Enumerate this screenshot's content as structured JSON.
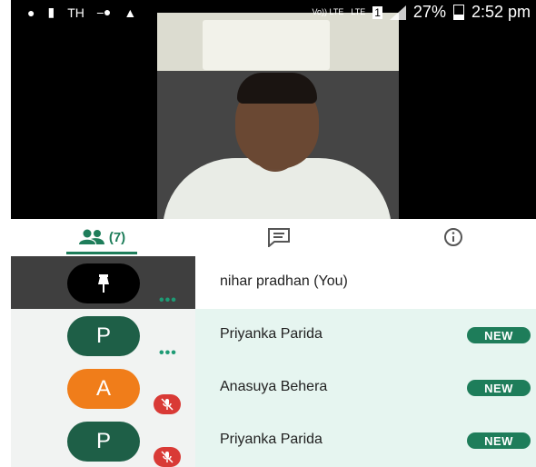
{
  "status_bar": {
    "carrier_text": "TH",
    "network_labels": [
      "Vo)) LTE",
      "LTE"
    ],
    "sim_slot": "1",
    "battery": "27%",
    "time": "2:52 pm"
  },
  "tabs": [
    {
      "name": "people",
      "icon": "people-icon",
      "count": "(7)",
      "selected": true
    },
    {
      "name": "chat",
      "icon": "chat-icon"
    },
    {
      "name": "info",
      "icon": "info-icon"
    }
  ],
  "participants": [
    {
      "name": "nihar pradhan (You)",
      "avatar_icon": "pin-icon",
      "avatar_color": "#000000",
      "self": true,
      "menu": "•••"
    },
    {
      "name": "Priyanka Parida",
      "initial": "P",
      "avatar_color": "#1e5f47",
      "badge": "NEW",
      "menu": "•••"
    },
    {
      "name": "Anasuya Behera",
      "initial": "A",
      "avatar_color": "#f07d1a",
      "badge": "NEW",
      "muted": true
    },
    {
      "name": "Priyanka Parida",
      "initial": "P",
      "avatar_color": "#1e5f47",
      "badge": "NEW",
      "muted": true
    }
  ],
  "colors": {
    "accent": "#1e7d5a",
    "mute": "#d93a36",
    "row_highlight": "#e6f5f0"
  }
}
